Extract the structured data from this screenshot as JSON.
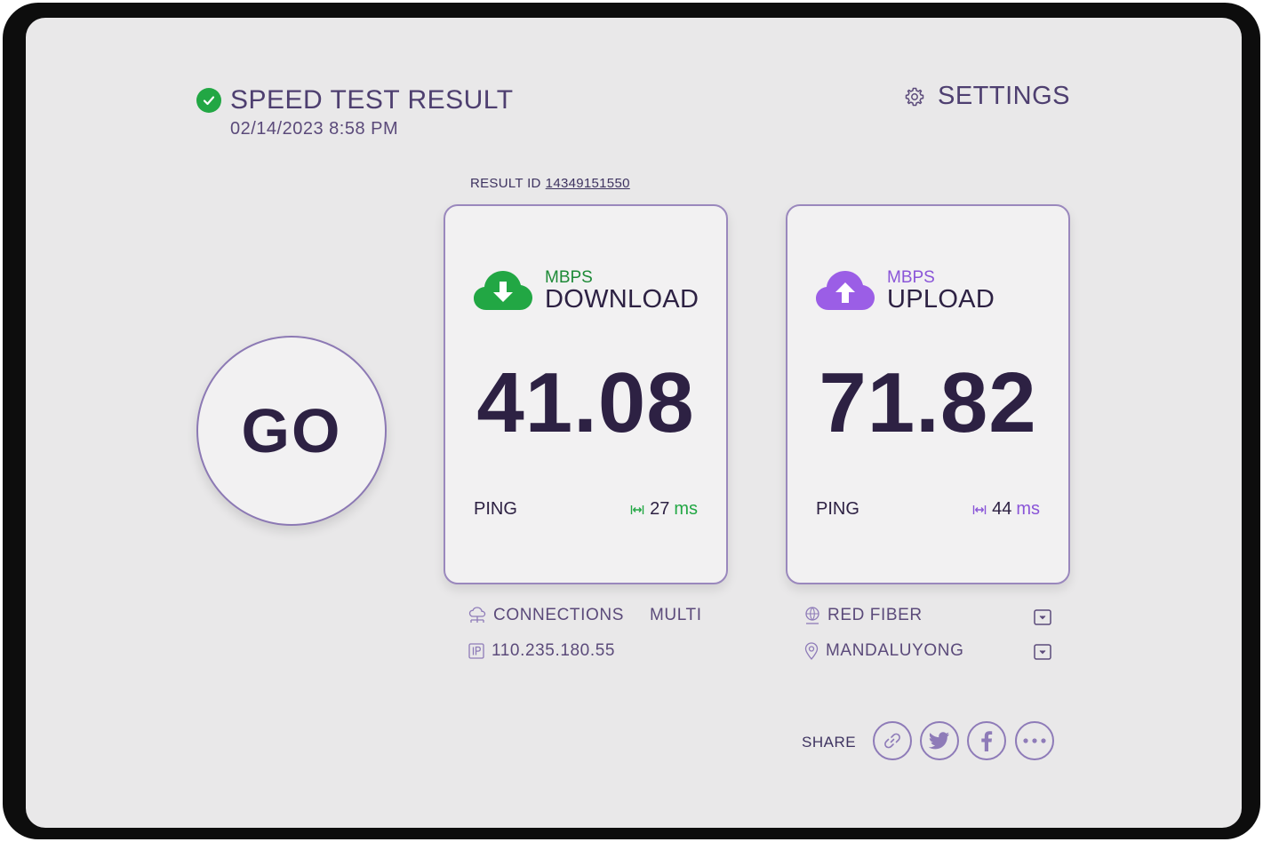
{
  "header": {
    "title": "SPEED TEST RESULT",
    "timestamp": "02/14/2023 8:58 PM",
    "settings_label": "SETTINGS"
  },
  "result": {
    "label": "RESULT ID",
    "id": "14349151550"
  },
  "go_label": "GO",
  "download": {
    "unit": "MBPS",
    "label": "DOWNLOAD",
    "value": "41.08",
    "ping_label": "PING",
    "ping_value": "27",
    "ping_unit": "ms"
  },
  "upload": {
    "unit": "MBPS",
    "label": "UPLOAD",
    "value": "71.82",
    "ping_label": "PING",
    "ping_value": "44",
    "ping_unit": "ms"
  },
  "info": {
    "connections_label": "CONNECTIONS",
    "connections_value": "MULTI",
    "ip": "110.235.180.55",
    "provider": "RED FIBER",
    "location": "MANDALUYONG"
  },
  "share": {
    "label": "SHARE"
  },
  "icons": [
    "check-icon",
    "gear-icon",
    "download-cloud-icon",
    "upload-cloud-icon",
    "ping-icon",
    "network-icon",
    "ip-icon",
    "globe-person-icon",
    "location-pin-icon",
    "dropdown-icon",
    "link-icon",
    "twitter-icon",
    "facebook-icon",
    "more-icon"
  ],
  "colors": {
    "green": "#22a744",
    "purple": "#8a55d8",
    "text_dark": "#2d2143",
    "text_muted": "#5b4a7a",
    "border": "#9a88bd"
  }
}
